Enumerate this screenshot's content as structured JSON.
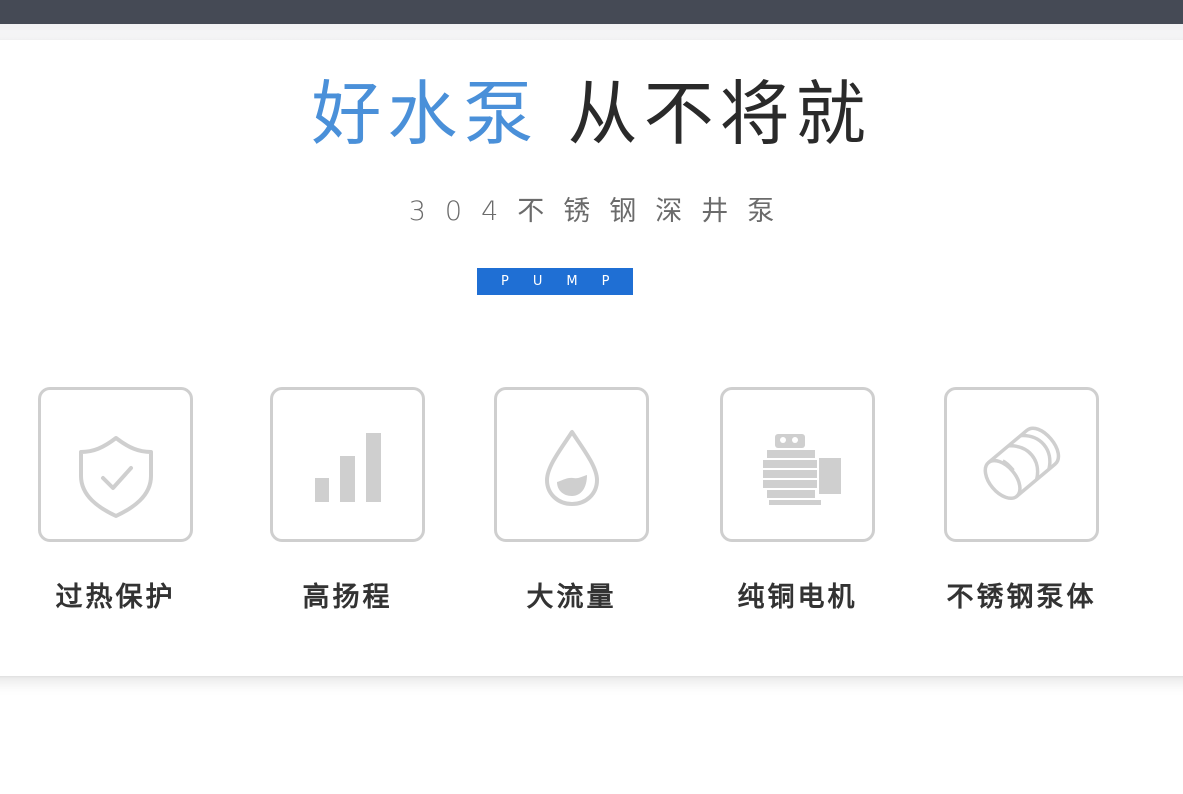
{
  "header": {
    "title_blue": "好水泵",
    "title_dark": "从不将就",
    "subtitle": "304不锈钢深井泵",
    "badge": "PUMP"
  },
  "features": [
    {
      "label": "过热保护",
      "icon": "shield-check-icon"
    },
    {
      "label": "高扬程",
      "icon": "signal-bars-icon"
    },
    {
      "label": "大流量",
      "icon": "water-drop-icon"
    },
    {
      "label": "纯铜电机",
      "icon": "motor-icon"
    },
    {
      "label": "不锈钢泵体",
      "icon": "steel-pipe-icon"
    }
  ],
  "colors": {
    "accent_blue": "#4a90d9",
    "badge_blue": "#1f6fd4",
    "top_bar": "#454a55",
    "icon_gray": "#cfcfcf"
  }
}
